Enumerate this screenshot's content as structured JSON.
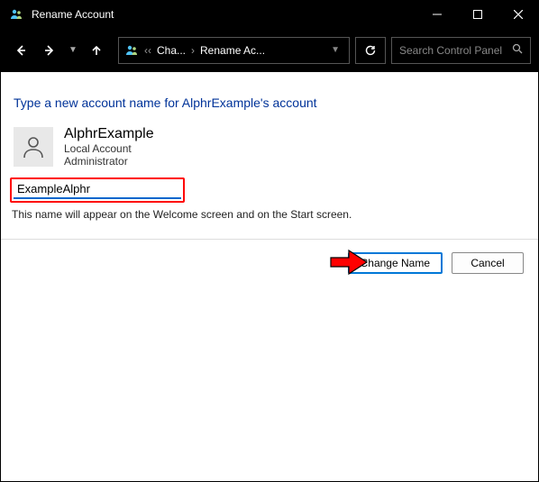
{
  "window": {
    "title": "Rename Account"
  },
  "nav": {
    "crumb1": "Cha...",
    "crumb2": "Rename Ac..."
  },
  "search": {
    "placeholder": "Search Control Panel"
  },
  "page": {
    "heading": "Type a new account name for AlphrExample's account",
    "hint": "This name will appear on the Welcome screen and on the Start screen."
  },
  "user": {
    "name": "AlphrExample",
    "type": "Local Account",
    "role": "Administrator"
  },
  "input": {
    "value": "ExampleAlphr"
  },
  "buttons": {
    "change": "Change Name",
    "cancel": "Cancel"
  }
}
